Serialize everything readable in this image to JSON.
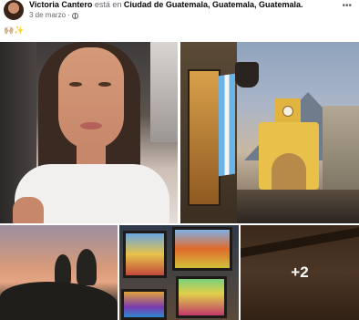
{
  "post": {
    "author": "Victoria Cantero",
    "action": "está en",
    "location": "Ciudad de Guatemala, Guatemala, Guatemala.",
    "date": "3 de marzo",
    "separator": "·",
    "more_menu": "•••",
    "caption": "🙌🏼✨",
    "privacy_icon": "globe-icon"
  },
  "photos": {
    "more_count": "+2"
  }
}
